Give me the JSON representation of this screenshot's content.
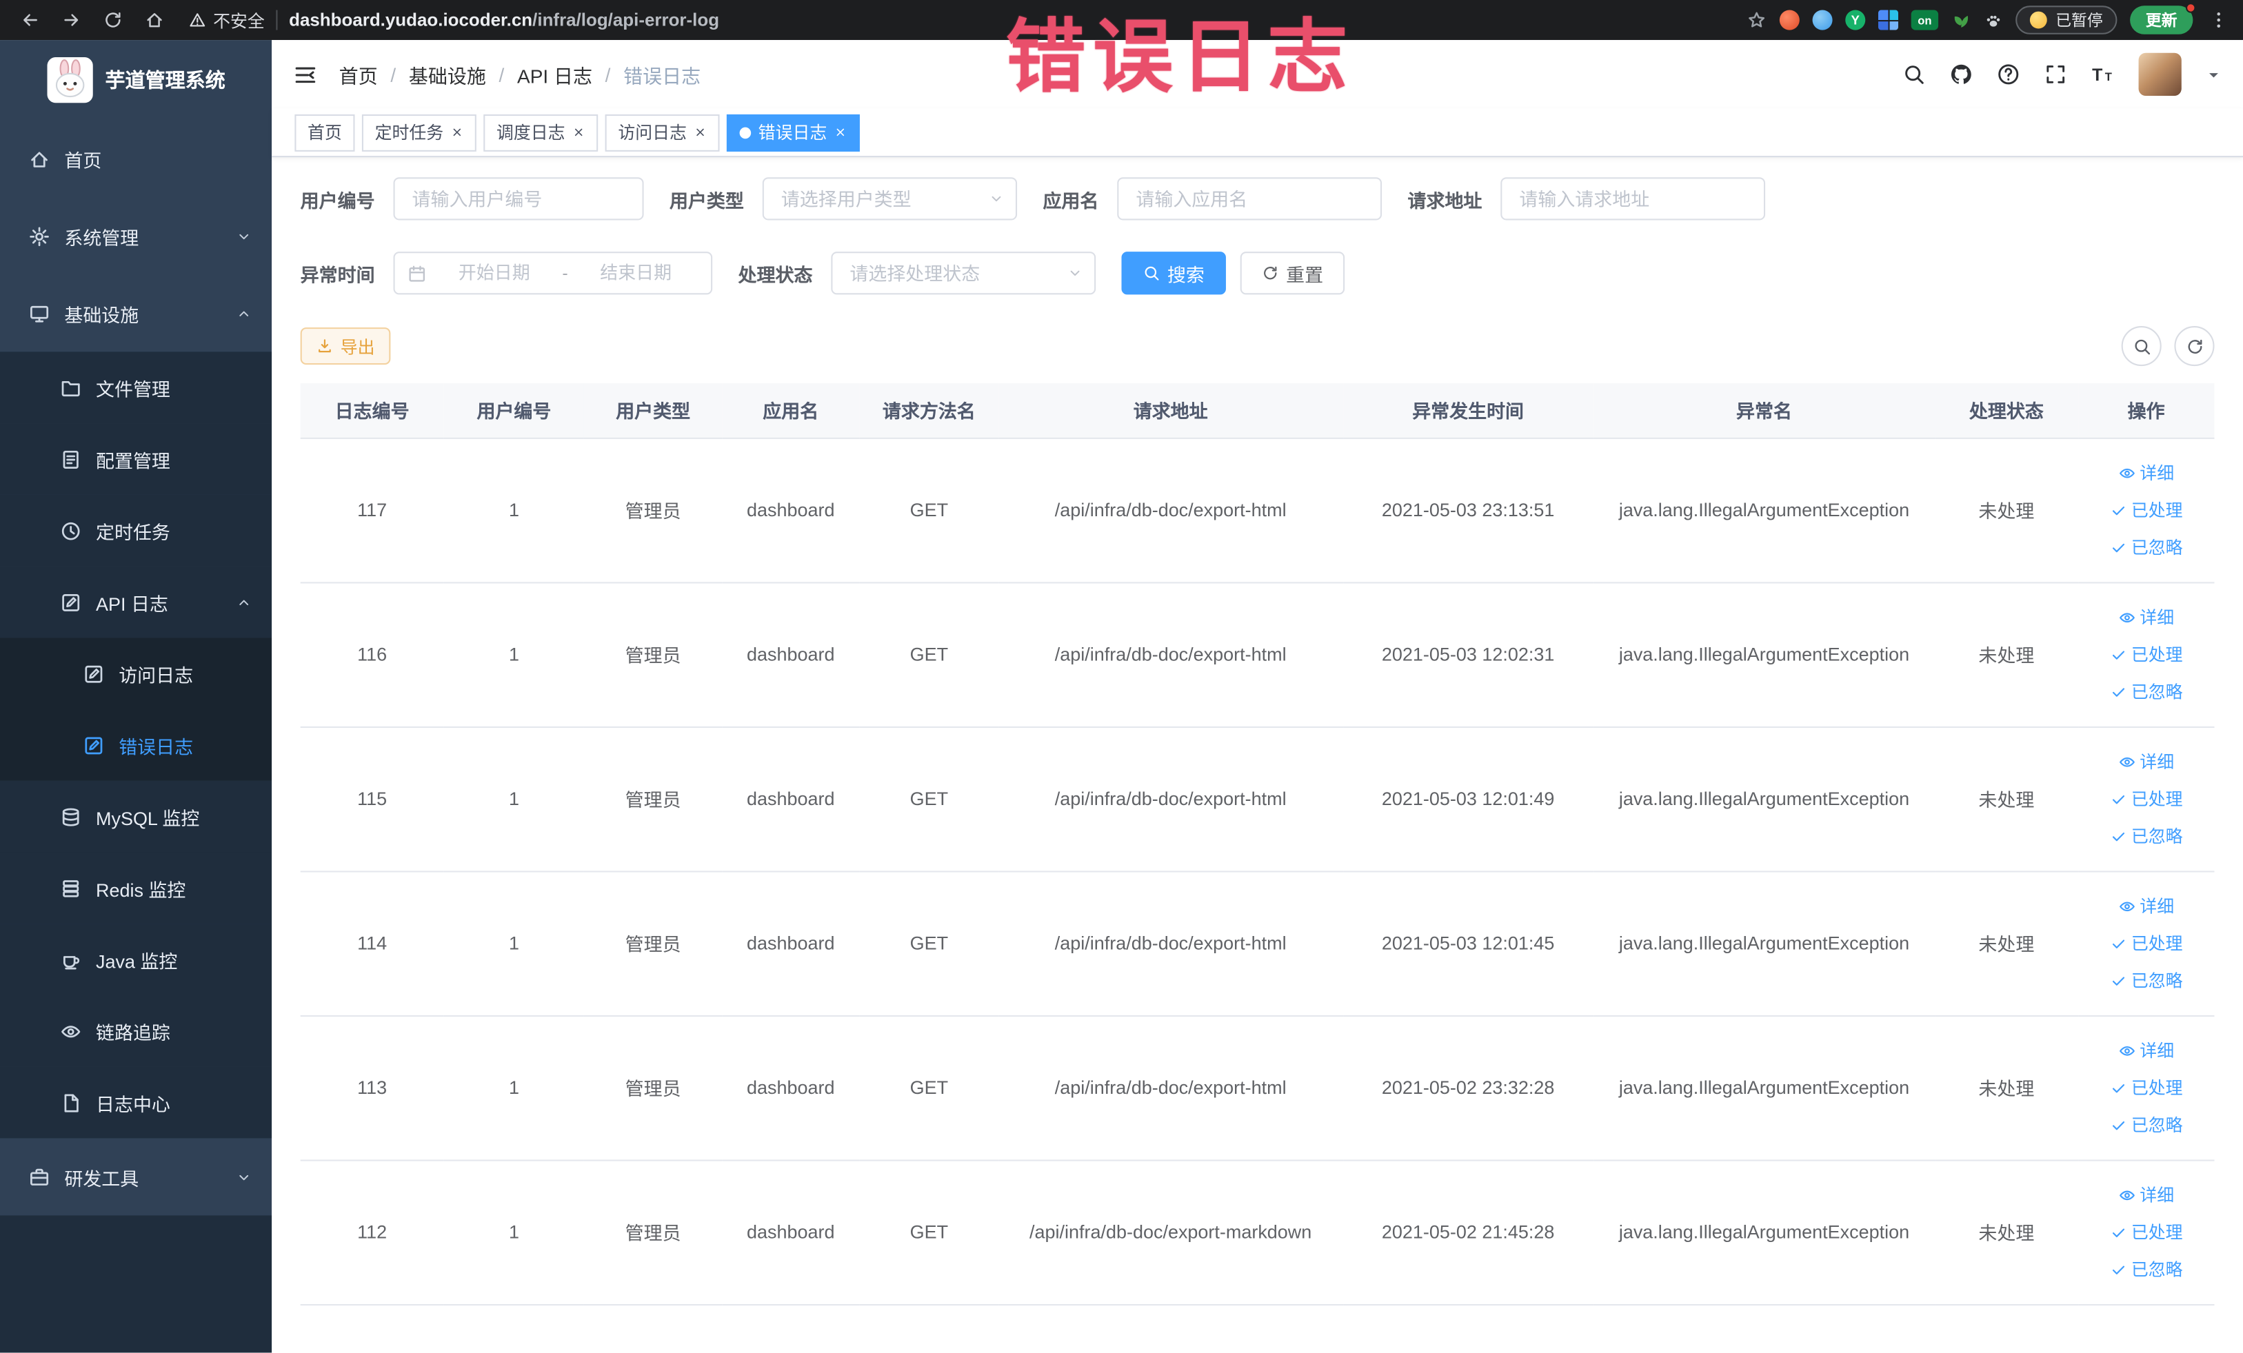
{
  "browser": {
    "security_label": "不安全",
    "url_domain": "dashboard.yudao.iocoder.cn",
    "url_path": "/infra/log/api-error-log",
    "paused_badge": "已暂停",
    "update_button": "更新",
    "extension_on_badge": "on",
    "extension_y_badge": "Y"
  },
  "annotation": {
    "text": "错误日志",
    "color": "#e94f6b"
  },
  "sidebar": {
    "title": "芋道管理系统",
    "items": [
      {
        "key": "home",
        "label": "首页",
        "icon": "home-icon",
        "level": 1
      },
      {
        "key": "system-management",
        "label": "系统管理",
        "icon": "gear-icon",
        "level": 1,
        "chevron": "down"
      },
      {
        "key": "infrastructure",
        "label": "基础设施",
        "icon": "infra-icon",
        "level": 1,
        "chevron": "up"
      },
      {
        "key": "file-management",
        "label": "文件管理",
        "icon": "folder-icon",
        "level": 2
      },
      {
        "key": "config-management",
        "label": "配置管理",
        "icon": "config-icon",
        "level": 2
      },
      {
        "key": "scheduled-tasks",
        "label": "定时任务",
        "icon": "clock-icon",
        "level": 2
      },
      {
        "key": "api-logs",
        "label": "API 日志",
        "icon": "edit-doc-icon",
        "level": 2,
        "chevron": "up"
      },
      {
        "key": "access-log",
        "label": "访问日志",
        "icon": "edit-doc-icon",
        "level": 3
      },
      {
        "key": "error-log",
        "label": "错误日志",
        "icon": "edit-doc-icon",
        "level": 3,
        "active": true
      },
      {
        "key": "mysql-monitor",
        "label": "MySQL 监控",
        "icon": "db-icon",
        "level": 2
      },
      {
        "key": "redis-monitor",
        "label": "Redis 监控",
        "icon": "stack-icon",
        "level": 2
      },
      {
        "key": "java-monitor",
        "label": "Java 监控",
        "icon": "cup-icon",
        "level": 2
      },
      {
        "key": "tracing",
        "label": "链路追踪",
        "icon": "eye-icon",
        "level": 2
      },
      {
        "key": "log-center",
        "label": "日志中心",
        "icon": "doc-icon",
        "level": 2
      },
      {
        "key": "dev-tools",
        "label": "研发工具",
        "icon": "briefcase-icon",
        "level": 1,
        "chevron": "down"
      }
    ]
  },
  "header": {
    "breadcrumb": [
      "首页",
      "基础设施",
      "API 日志",
      "错误日志"
    ]
  },
  "tabs": [
    {
      "key": "home",
      "label": "首页",
      "closable": false,
      "active": false
    },
    {
      "key": "scheduled-tasks",
      "label": "定时任务",
      "closable": true,
      "active": false
    },
    {
      "key": "job-log",
      "label": "调度日志",
      "closable": true,
      "active": false
    },
    {
      "key": "access-log",
      "label": "访问日志",
      "closable": true,
      "active": false
    },
    {
      "key": "error-log",
      "label": "错误日志",
      "closable": true,
      "active": true
    }
  ],
  "filters": {
    "user_id": {
      "label": "用户编号",
      "placeholder": "请输入用户编号"
    },
    "user_type": {
      "label": "用户类型",
      "placeholder": "请选择用户类型"
    },
    "app_name": {
      "label": "应用名",
      "placeholder": "请输入应用名"
    },
    "request_url": {
      "label": "请求地址",
      "placeholder": "请输入请求地址"
    },
    "exception_time": {
      "label": "异常时间",
      "start_placeholder": "开始日期",
      "separator": "-",
      "end_placeholder": "结束日期"
    },
    "process_status": {
      "label": "处理状态",
      "placeholder": "请选择处理状态"
    },
    "search_button": "搜索",
    "reset_button": "重置"
  },
  "toolbar": {
    "export_button": "导出"
  },
  "table": {
    "columns": [
      {
        "key": "log-id",
        "label": "日志编号"
      },
      {
        "key": "user-id",
        "label": "用户编号"
      },
      {
        "key": "user-type",
        "label": "用户类型"
      },
      {
        "key": "app-name",
        "label": "应用名"
      },
      {
        "key": "method-name",
        "label": "请求方法名"
      },
      {
        "key": "request-url",
        "label": "请求地址"
      },
      {
        "key": "exception-time",
        "label": "异常发生时间"
      },
      {
        "key": "exception-name",
        "label": "异常名"
      },
      {
        "key": "process-status",
        "label": "处理状态"
      },
      {
        "key": "actions",
        "label": "操作"
      }
    ],
    "rows": [
      [
        "117",
        "1",
        "管理员",
        "dashboard",
        "GET",
        "/api/infra/db-doc/export-html",
        "2021-05-03 23:13:51",
        "java.lang.IllegalArgumentException",
        "未处理"
      ],
      [
        "116",
        "1",
        "管理员",
        "dashboard",
        "GET",
        "/api/infra/db-doc/export-html",
        "2021-05-03 12:02:31",
        "java.lang.IllegalArgumentException",
        "未处理"
      ],
      [
        "115",
        "1",
        "管理员",
        "dashboard",
        "GET",
        "/api/infra/db-doc/export-html",
        "2021-05-03 12:01:49",
        "java.lang.IllegalArgumentException",
        "未处理"
      ],
      [
        "114",
        "1",
        "管理员",
        "dashboard",
        "GET",
        "/api/infra/db-doc/export-html",
        "2021-05-03 12:01:45",
        "java.lang.IllegalArgumentException",
        "未处理"
      ],
      [
        "113",
        "1",
        "管理员",
        "dashboard",
        "GET",
        "/api/infra/db-doc/export-html",
        "2021-05-02 23:32:28",
        "java.lang.IllegalArgumentException",
        "未处理"
      ],
      [
        "112",
        "1",
        "管理员",
        "dashboard",
        "GET",
        "/api/infra/db-doc/export-markdown",
        "2021-05-02 21:45:28",
        "java.lang.IllegalArgumentException",
        "未处理"
      ]
    ],
    "row_actions": [
      {
        "key": "detail",
        "label": "详细",
        "icon": "eye-icon"
      },
      {
        "key": "processed",
        "label": "已处理",
        "icon": "check-icon"
      },
      {
        "key": "ignored",
        "label": "已忽略",
        "icon": "check-icon"
      }
    ]
  },
  "colors": {
    "primary": "#409eff",
    "sidebar_bg": "#304156",
    "submenu_bg": "#1f2d3d",
    "warning": "#e6a23c",
    "annotation": "#e94f6b"
  }
}
